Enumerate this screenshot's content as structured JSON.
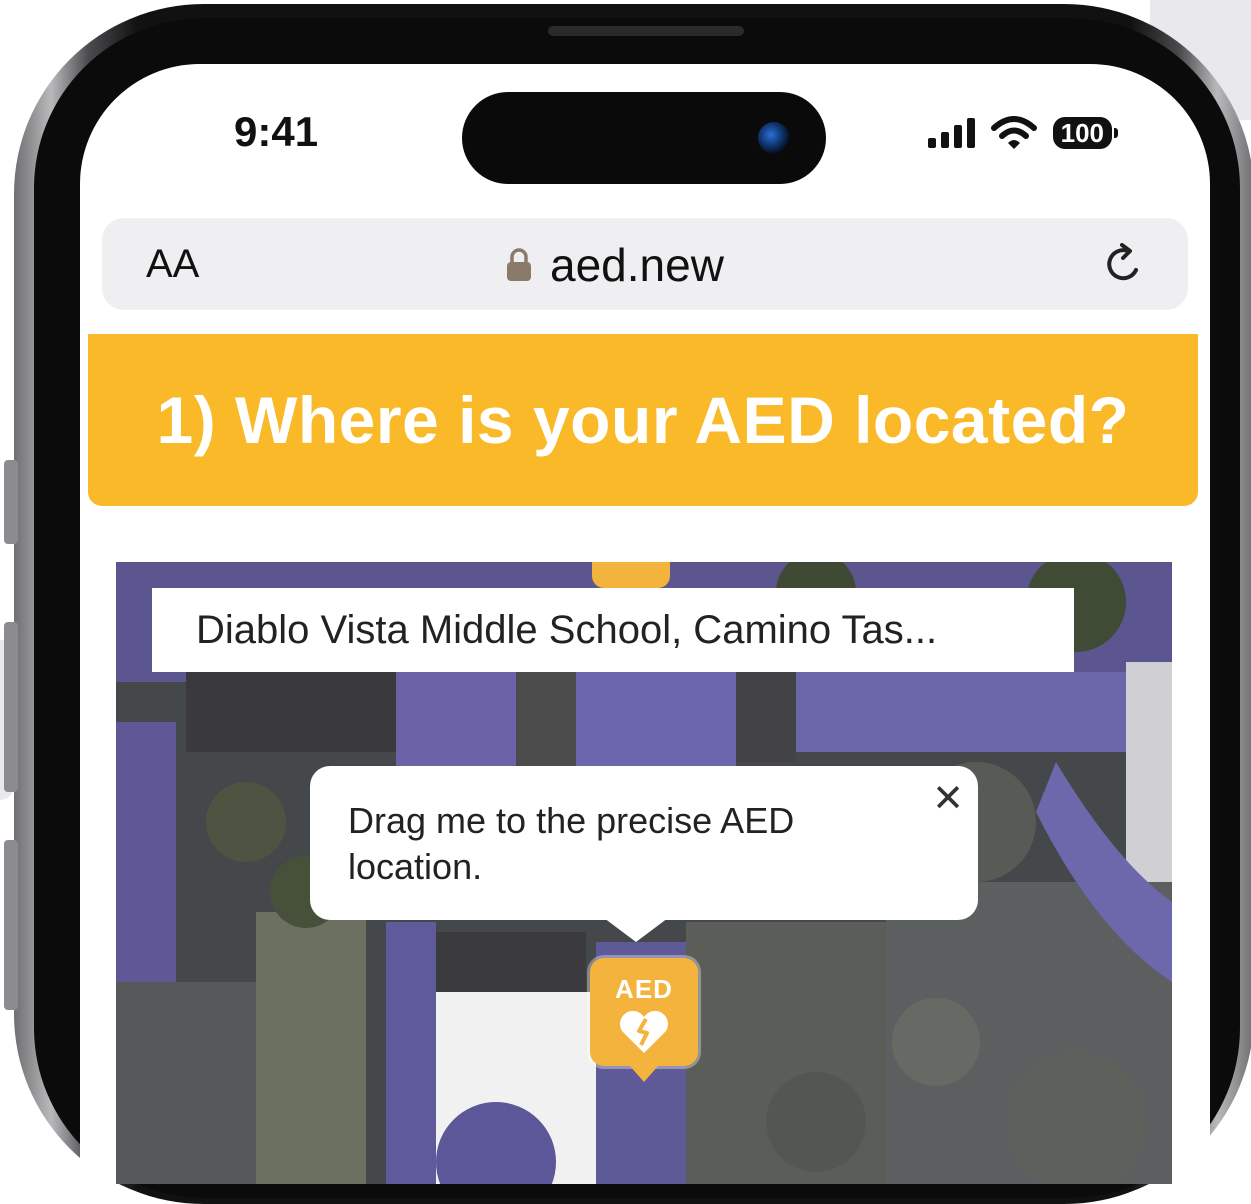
{
  "status_bar": {
    "time": "9:41",
    "battery": "100"
  },
  "browser": {
    "text_size_button": "AA",
    "url": "aed.new",
    "reload_icon": "reload-icon",
    "lock_icon": "lock-icon"
  },
  "page": {
    "title": "1) Where is your AED located?"
  },
  "map": {
    "search_value": "Diablo Vista Middle School, Camino Tas...",
    "tooltip_text": "Drag me to the precise AED location.",
    "close_icon": "close-icon",
    "marker_label": "AED",
    "marker_icon": "broken-heart-icon"
  },
  "colors": {
    "accent": "#f9b928",
    "marker": "#f3b33c"
  }
}
